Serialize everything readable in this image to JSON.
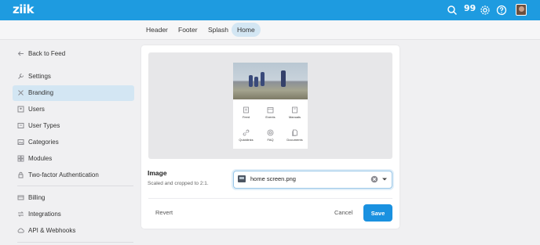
{
  "app": {
    "logo": "ziik"
  },
  "topbar": {
    "quote_label": "99",
    "accent": "#1e9be0"
  },
  "tabs": [
    {
      "label": "Header",
      "active": false
    },
    {
      "label": "Footer",
      "active": false
    },
    {
      "label": "Splash",
      "active": false
    },
    {
      "label": "Home",
      "active": true
    }
  ],
  "sidebar": {
    "items": [
      {
        "label": "Back to Feed",
        "icon": "arrow-left-icon"
      },
      {
        "label": "Settings",
        "icon": "wrench-icon"
      },
      {
        "label": "Branding",
        "icon": "brush-icon",
        "active": true
      },
      {
        "label": "Users",
        "icon": "users-icon"
      },
      {
        "label": "User Types",
        "icon": "id-card-icon"
      },
      {
        "label": "Categories",
        "icon": "image-icon"
      },
      {
        "label": "Modules",
        "icon": "grid-icon"
      },
      {
        "label": "Two-factor Authentication",
        "icon": "lock-icon"
      },
      {
        "label": "Billing",
        "icon": "card-icon"
      },
      {
        "label": "Integrations",
        "icon": "arrows-icon"
      },
      {
        "label": "API & Webhooks",
        "icon": "cloud-icon"
      }
    ]
  },
  "preview": {
    "grid": [
      {
        "label": "Feed",
        "icon": "feed-icon"
      },
      {
        "label": "Events",
        "icon": "calendar-icon"
      },
      {
        "label": "Manuals",
        "icon": "book-icon"
      },
      {
        "label": "Quicklinks",
        "icon": "link-icon"
      },
      {
        "label": "FAQ",
        "icon": "help-icon"
      },
      {
        "label": "Documents",
        "icon": "documents-icon"
      }
    ]
  },
  "image_field": {
    "label": "Image",
    "hint": "Scaled and cropped to 2:1.",
    "value": "home screen.png"
  },
  "actions": {
    "revert": "Revert",
    "cancel": "Cancel",
    "save": "Save",
    "save_color": "#1a91e0"
  }
}
